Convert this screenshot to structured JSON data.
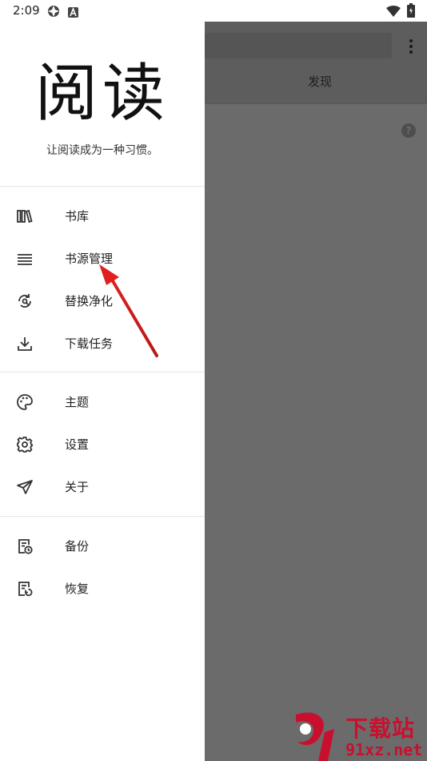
{
  "status_bar": {
    "time": "2:09",
    "icons": [
      "settings-gear-icon",
      "a-badge-icon",
      "wifi-icon",
      "battery-icon"
    ]
  },
  "drawer": {
    "logo_text": "阅读",
    "slogan": "让阅读成为一种习惯。",
    "groups": [
      [
        {
          "label": "书库",
          "icon": "bookshelf-icon"
        },
        {
          "label": "书源管理",
          "icon": "list-icon"
        },
        {
          "label": "替换净化",
          "icon": "replace-sync-icon"
        },
        {
          "label": "下载任务",
          "icon": "download-icon"
        }
      ],
      [
        {
          "label": "主题",
          "icon": "palette-icon"
        },
        {
          "label": "设置",
          "icon": "gear-icon"
        },
        {
          "label": "关于",
          "icon": "paper-plane-icon"
        }
      ],
      [
        {
          "label": "备份",
          "icon": "backup-icon"
        },
        {
          "label": "恢复",
          "icon": "restore-icon"
        }
      ]
    ]
  },
  "background": {
    "tab_label": "发现",
    "help_icon": "help-circle-icon"
  },
  "watermark": {
    "title": "下载站",
    "url": "91xz.net"
  },
  "colors": {
    "scrim": "#6b6b6b",
    "drawer_bg": "#ffffff",
    "annotation_arrow": "#e02020",
    "watermark": "#c8102e"
  }
}
